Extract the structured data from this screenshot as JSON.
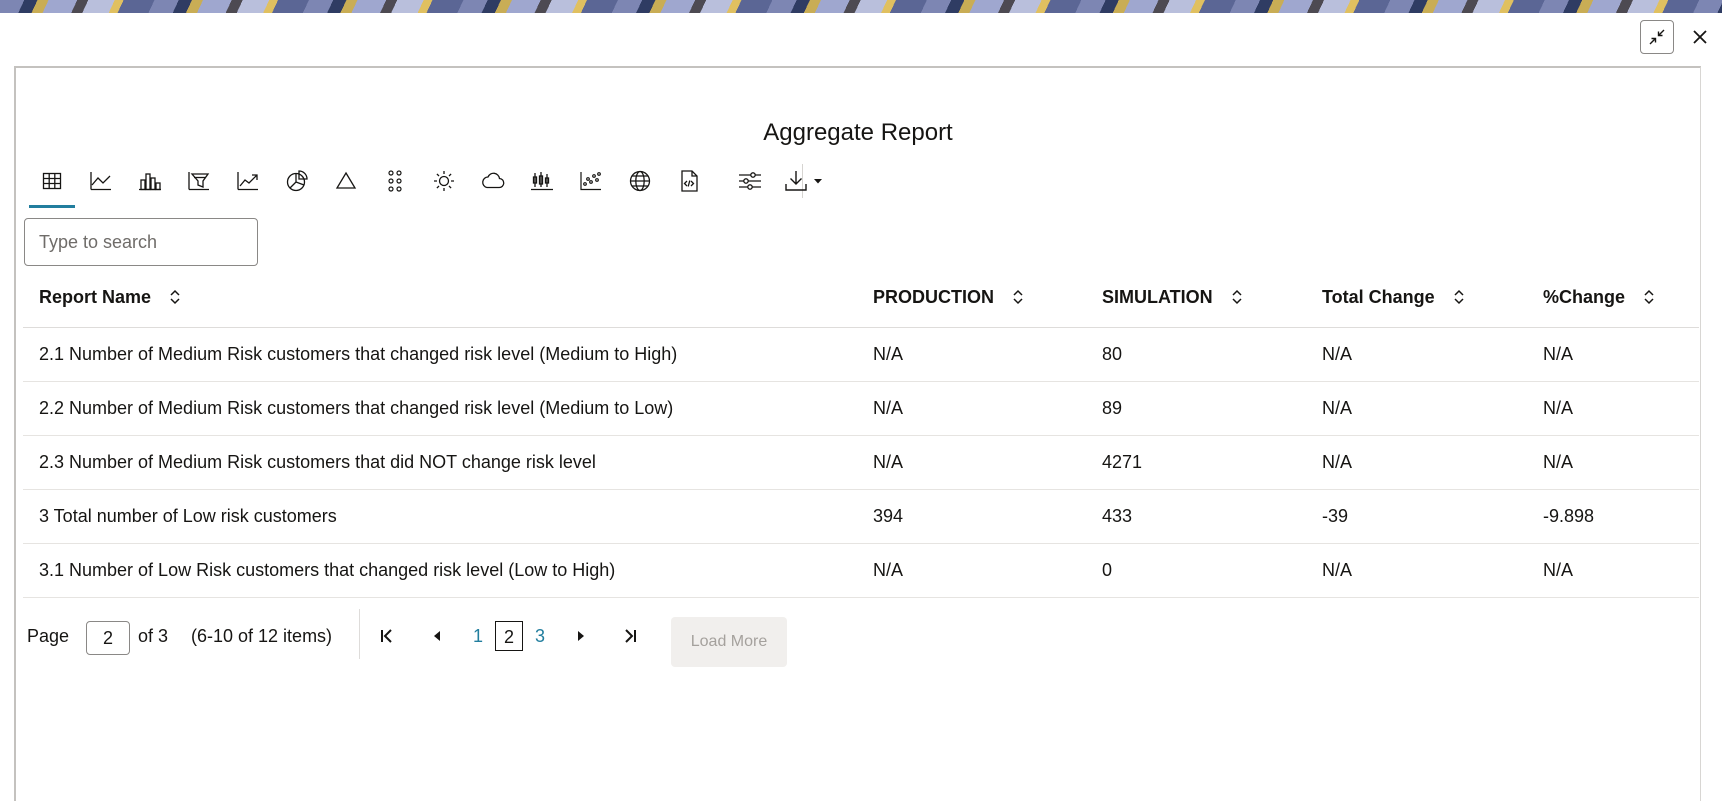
{
  "window": {
    "restore_icon": "collapse-arrows-icon",
    "close_icon": "close-icon"
  },
  "report": {
    "title": "Aggregate Report"
  },
  "toolbar": {
    "tools": [
      {
        "icon": "table-view-icon",
        "active": true
      },
      {
        "icon": "line-chart-icon"
      },
      {
        "icon": "bar-chart-icon"
      },
      {
        "icon": "funnel-chart-icon"
      },
      {
        "icon": "trend-chart-icon"
      },
      {
        "icon": "pie-chart-icon"
      },
      {
        "icon": "pyramid-chart-icon"
      },
      {
        "icon": "dot-matrix-icon"
      },
      {
        "icon": "sunburst-chart-icon"
      },
      {
        "icon": "tag-cloud-icon"
      },
      {
        "icon": "box-plot-icon"
      },
      {
        "icon": "scatter-chart-icon"
      },
      {
        "icon": "globe-map-icon"
      },
      {
        "icon": "code-export-icon"
      },
      {
        "icon": "filter-settings-icon"
      },
      {
        "icon": "download-icon"
      }
    ],
    "accent": "#227e9e"
  },
  "search": {
    "placeholder": "Type to search",
    "value": ""
  },
  "table": {
    "columns": [
      "Report Name",
      "PRODUCTION",
      "SIMULATION",
      "Total Change",
      "%Change"
    ],
    "rows": [
      [
        "2.1 Number of Medium Risk customers that changed risk level (Medium to High)",
        "N/A",
        "80",
        "N/A",
        "N/A"
      ],
      [
        "2.2 Number of Medium Risk customers that changed risk level (Medium to Low)",
        "N/A",
        "89",
        "N/A",
        "N/A"
      ],
      [
        "2.3 Number of Medium Risk customers that did NOT change risk level",
        "N/A",
        "4271",
        "N/A",
        "N/A"
      ],
      [
        "3 Total number of Low risk customers",
        "394",
        "433",
        "-39",
        "-9.898"
      ],
      [
        "3.1 Number of Low Risk customers that changed risk level (Low to High)",
        "N/A",
        "0",
        "N/A",
        "N/A"
      ]
    ]
  },
  "pagination": {
    "page_label": "Page",
    "current_page": "2",
    "of_label": "of 3",
    "range_label": "(6-10 of 12 items)",
    "pages": [
      "1",
      "2",
      "3"
    ],
    "load_more": "Load More"
  }
}
